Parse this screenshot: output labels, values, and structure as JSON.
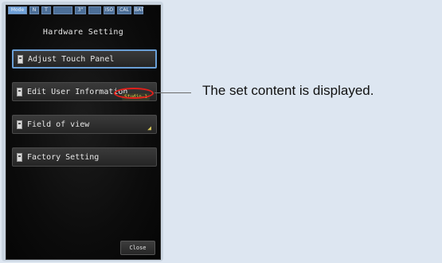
{
  "status_bar": [
    "Mode",
    "N",
    "T",
    "",
    "3\"",
    "",
    "ISO",
    "CAL",
    "BAT"
  ],
  "screen": {
    "title": "Hardware Setting",
    "menu": [
      {
        "label": "Adjust Touch Panel",
        "selected": true
      },
      {
        "label": "Edit User Information",
        "badge": "Studio-1"
      },
      {
        "label": "Field of view",
        "icon": "field-of-view-icon"
      },
      {
        "label": "Factory Setting"
      }
    ],
    "close_label": "Close"
  },
  "annotation": {
    "callout_text": "The set content is displayed."
  },
  "colors": {
    "background": "#dde6f1",
    "highlight_ellipse": "#e0201b",
    "selected_border": "#6a9fd6",
    "badge_text": "#e8d84a"
  }
}
